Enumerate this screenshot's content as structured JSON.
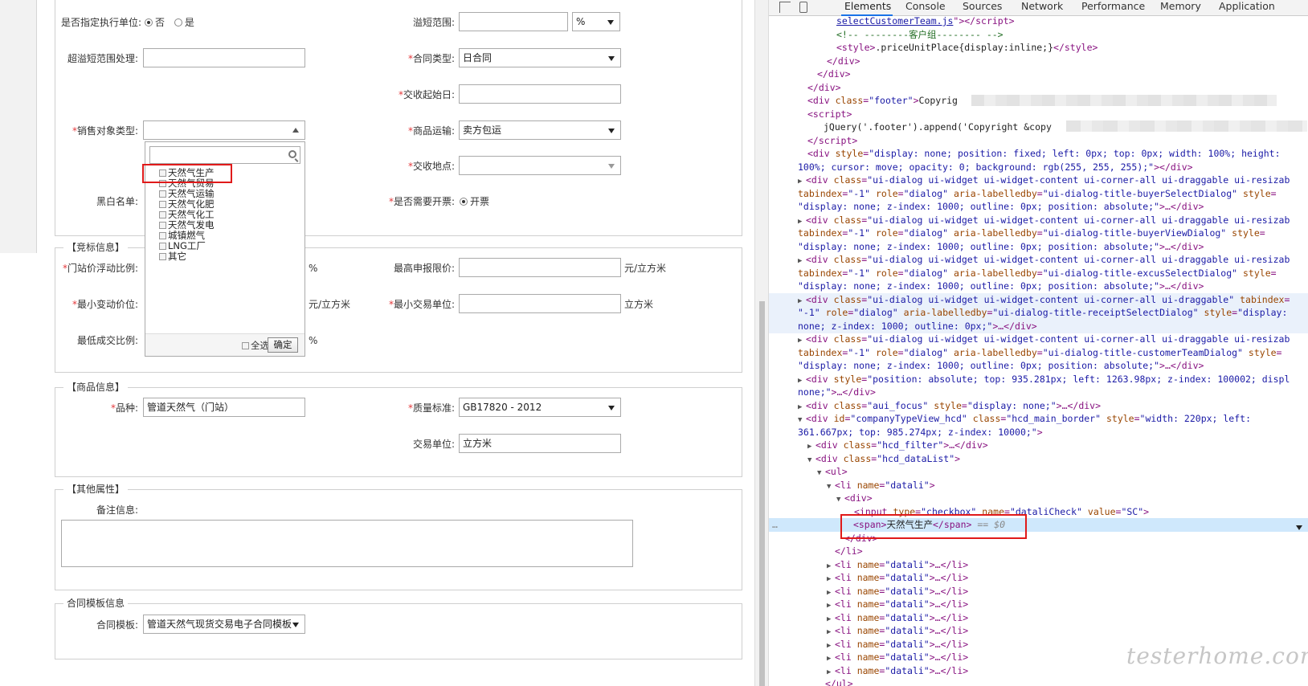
{
  "form": {
    "row1": {
      "designate_label": "是否指定执行单位:",
      "designate_no": "否",
      "designate_yes": "是",
      "overflow_label": "溢短范围:",
      "overflow_unit_value": "%"
    },
    "row2": {
      "over_handling_label": "超溢短范围处理:",
      "contract_type_label": "合同类型:",
      "contract_type_value": "日合同"
    },
    "row3": {
      "delivery_start_label": "交收起始日:"
    },
    "row4": {
      "sales_target_label": "销售对象类型:",
      "transport_label": "商品运输:",
      "transport_value": "卖方包运"
    },
    "row5": {
      "delivery_place_label": "交收地点:"
    },
    "row6": {
      "blacklist_label": "黑白名单:",
      "invoice_label": "是否需要开票:",
      "invoice_value": "开票"
    },
    "bidding": {
      "legend": "【竞标信息】",
      "float_ratio_label": "门站价浮动比例:",
      "float_ratio_unit": "%",
      "max_price_label": "最高申报限价:",
      "max_price_unit": "元/立方米",
      "min_change_label": "最小变动价位:",
      "min_change_unit": "元/立方米",
      "min_trade_label": "最小交易单位:",
      "min_trade_unit": "立方米",
      "min_deal_label": "最低成交比例:",
      "min_deal_unit": "%"
    },
    "goods": {
      "legend": "【商品信息】",
      "variety_label": "品种:",
      "variety_value": "管道天然气（门站）",
      "quality_label": "质量标准:",
      "quality_value": "GB17820 - 2012",
      "trade_unit_label": "交易单位:",
      "trade_unit_value": "立方米"
    },
    "other": {
      "legend": "【其他属性】",
      "remark_label": "备注信息:"
    },
    "template": {
      "legend": "合同模板信息",
      "template_label": "合同模板:",
      "template_value": "管道天然气现货交易电子合同模板"
    }
  },
  "dropdown": {
    "items": [
      "天然气生产",
      "天然气贸易",
      "天然气运输",
      "天然气化肥",
      "天然气化工",
      "天然气发电",
      "城镇燃气",
      "LNG工厂",
      "其它"
    ],
    "select_all": "全选",
    "ok": "确定"
  },
  "devtools": {
    "tabs": [
      "Elements",
      "Console",
      "Sources",
      "Network",
      "Performance",
      "Memory",
      "Application"
    ],
    "active_tab": "Elements"
  },
  "watermark": "testerhome.com",
  "colors": {
    "required": "#e4393c",
    "highlight": "#e01a1a",
    "tag": "#881280",
    "attr_name": "#994500",
    "attr_value": "#1a1aa6",
    "comment": "#236e25",
    "selected_line": "#cfe8fc"
  }
}
